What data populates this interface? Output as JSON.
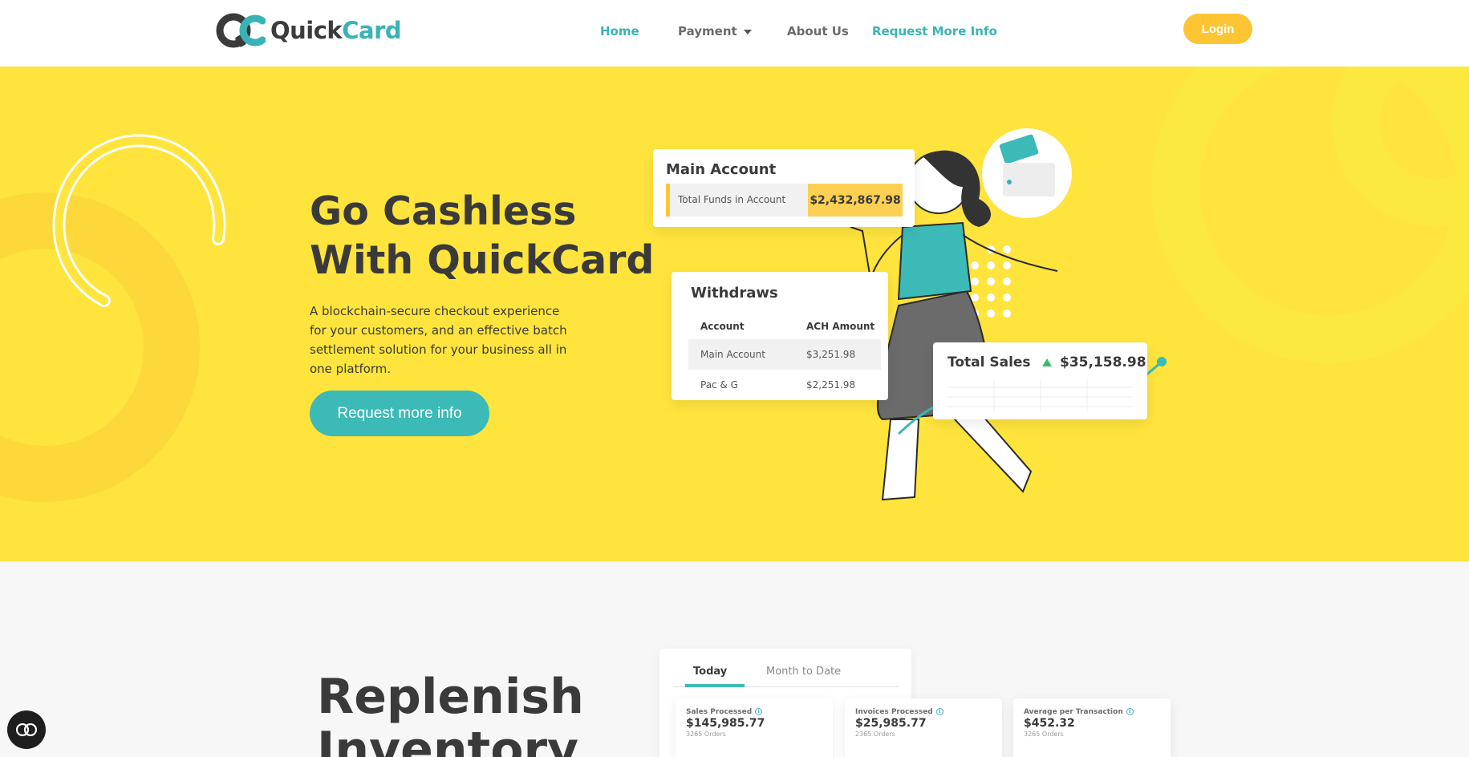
{
  "brand": {
    "name_part1": "Quick",
    "name_part2": "Card",
    "logo_icon": "qc-logo-icon",
    "colors": {
      "teal": "#3ab3b6",
      "yellow": "#fee43c",
      "gold": "#fdc534",
      "dark": "#3a3a3a"
    }
  },
  "nav": {
    "items": [
      {
        "label": "Home",
        "active": true
      },
      {
        "label": "Payment",
        "has_dropdown": true
      },
      {
        "label": "About Us"
      },
      {
        "label": "Request More Info",
        "highlight": true
      }
    ],
    "login_label": "Login"
  },
  "hero": {
    "title_line1": "Go Cashless",
    "title_line2": "With QuickCard",
    "description": "A blockchain-secure checkout experience for your customers, and an effective batch settlement solution for your business all in one platform.",
    "cta_label": "Request more info",
    "main_account": {
      "title": "Main Account",
      "label": "Total Funds in Account",
      "value": "$2,432,867.98"
    },
    "withdraws": {
      "title": "Withdraws",
      "headers": [
        "Account",
        "ACH Amount"
      ],
      "rows": [
        {
          "account": "Main Account",
          "amount": "$3,251.98"
        },
        {
          "account": "Pac & G",
          "amount": "$2,251.98"
        }
      ]
    },
    "total_sales": {
      "title": "Total Sales",
      "value": "$35,158.98",
      "trend_icon": "up-arrow-icon"
    }
  },
  "section2": {
    "title_line1": "Replenish",
    "title_line2": "Inventory",
    "tabs": [
      "Today",
      "Month to Date"
    ],
    "active_tab": "Today",
    "metrics": [
      {
        "label": "Sales Processed",
        "value": "$145,985.77",
        "sub": "3265 Orders"
      },
      {
        "label": "Invoices Processed",
        "value": "$25,985.77",
        "sub": "2365 Orders"
      },
      {
        "label": "Average per Transaction",
        "value": "$452.32",
        "sub": "3265 Orders"
      }
    ]
  },
  "chat": {
    "icon": "chat-icon"
  }
}
